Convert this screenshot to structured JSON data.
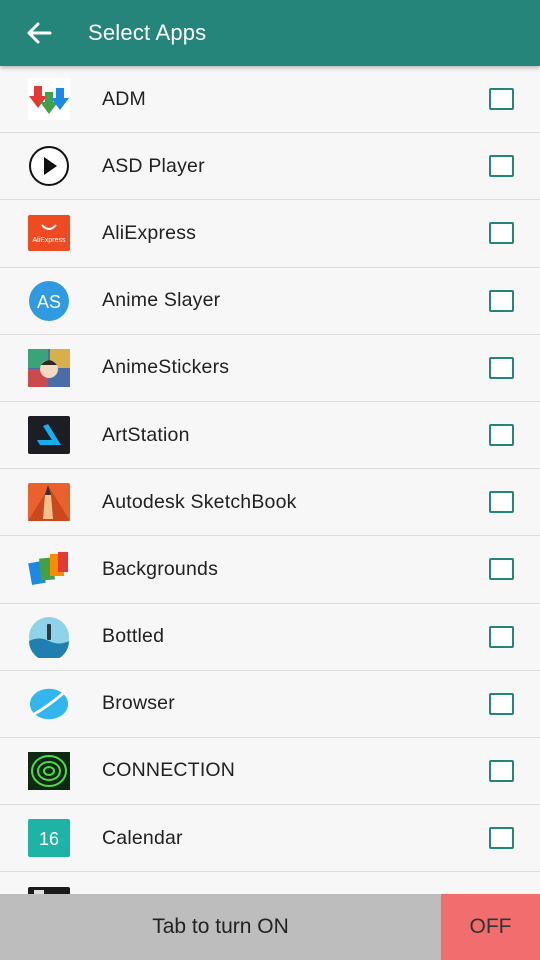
{
  "header": {
    "title": "Select Apps",
    "back_icon": "arrow-left-icon"
  },
  "apps": [
    {
      "label": "ADM",
      "icon": "adm-icon",
      "checked": false
    },
    {
      "label": "ASD Player",
      "icon": "play-circle-icon",
      "checked": false
    },
    {
      "label": "AliExpress",
      "icon": "aliexpress-icon",
      "checked": false
    },
    {
      "label": "Anime Slayer",
      "icon": "anime-slayer-icon",
      "checked": false
    },
    {
      "label": "AnimeStickers",
      "icon": "anime-stickers-icon",
      "checked": false
    },
    {
      "label": "ArtStation",
      "icon": "artstation-icon",
      "checked": false
    },
    {
      "label": "Autodesk SketchBook",
      "icon": "sketchbook-icon",
      "checked": false
    },
    {
      "label": "Backgrounds",
      "icon": "backgrounds-icon",
      "checked": false
    },
    {
      "label": "Bottled",
      "icon": "bottled-icon",
      "checked": false
    },
    {
      "label": "Browser",
      "icon": "browser-icon",
      "checked": false
    },
    {
      "label": "CONNECTION",
      "icon": "connection-icon",
      "checked": false
    },
    {
      "label": "Calendar",
      "icon": "calendar-icon",
      "checked": false
    }
  ],
  "icon_text": {
    "aliexpress": "AliExpress",
    "anime_slayer": "AS",
    "calendar_day": "16"
  },
  "footer": {
    "toggle_label": "Tab to turn ON",
    "state_label": "OFF"
  },
  "colors": {
    "primary": "#25857a",
    "off": "#f26d6d",
    "footer_bg": "#bdbdbd"
  }
}
